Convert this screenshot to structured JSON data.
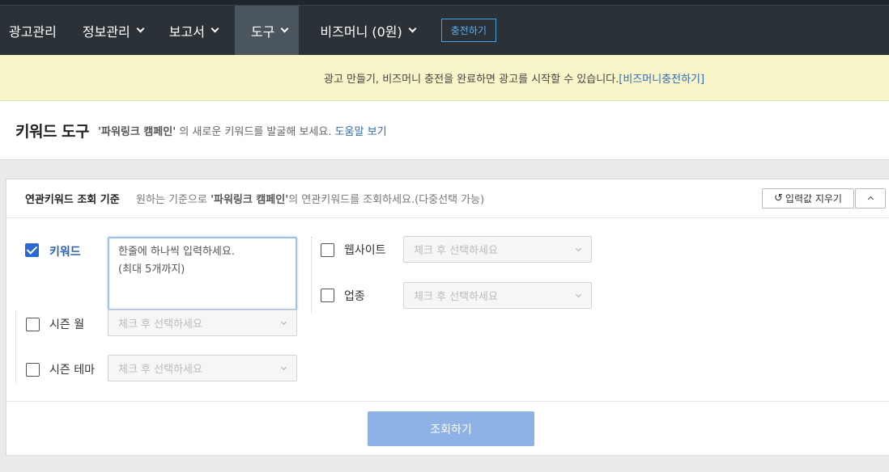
{
  "nav": {
    "items": [
      {
        "label": "광고관리"
      },
      {
        "label": "정보관리"
      },
      {
        "label": "보고서"
      },
      {
        "label": "도구"
      },
      {
        "label": "비즈머니 (0원)"
      }
    ],
    "charge_label": "충전하기"
  },
  "notice": {
    "text": "광고 만들기, 비즈머니 충전을 완료하면 광고를 시작할 수 있습니다.",
    "link": "[비즈머니충전하기]"
  },
  "page": {
    "title": "키워드 도구",
    "campaign": "'파워링크 캠페인'",
    "desc": " 의 새로운 키워드를 발굴해 보세요. ",
    "help": "도움말 보기"
  },
  "panel": {
    "title": "연관키워드 조회 기준",
    "desc_pre": "원하는 기준으로 ",
    "campaign": "'파워링크 캠페인'",
    "desc_post": "의 연관키워드를 조회하세요.(다중선택 가능)",
    "clear_label": "입력값 지우기",
    "keyword": {
      "label": "키워드",
      "checked": true,
      "placeholder": "한줄에 하나씩 입력하세요.\n(최대 5개까지)"
    },
    "website": {
      "label": "웹사이트",
      "checked": false,
      "select": "체크 후 선택하세요"
    },
    "industry": {
      "label": "업종",
      "checked": false,
      "select": "체크 후 선택하세요"
    },
    "season_month": {
      "label": "시즌 월",
      "checked": false,
      "select": "체크 후 선택하세요"
    },
    "season_theme": {
      "label": "시즌 테마",
      "checked": false,
      "select": "체크 후 선택하세요"
    },
    "search_label": "조회하기"
  },
  "colors": {
    "nav_bg": "#2b3237",
    "nav_active": "#4b555e",
    "notice_bg": "#f7f5c9",
    "link": "#2e6bb4",
    "search_button": "#8fb2e6",
    "checkbox_checked": "#2a6ad0"
  },
  "icons": [
    "chevron-down-icon",
    "undo-icon",
    "chevron-up-icon",
    "checkbox-icon"
  ]
}
